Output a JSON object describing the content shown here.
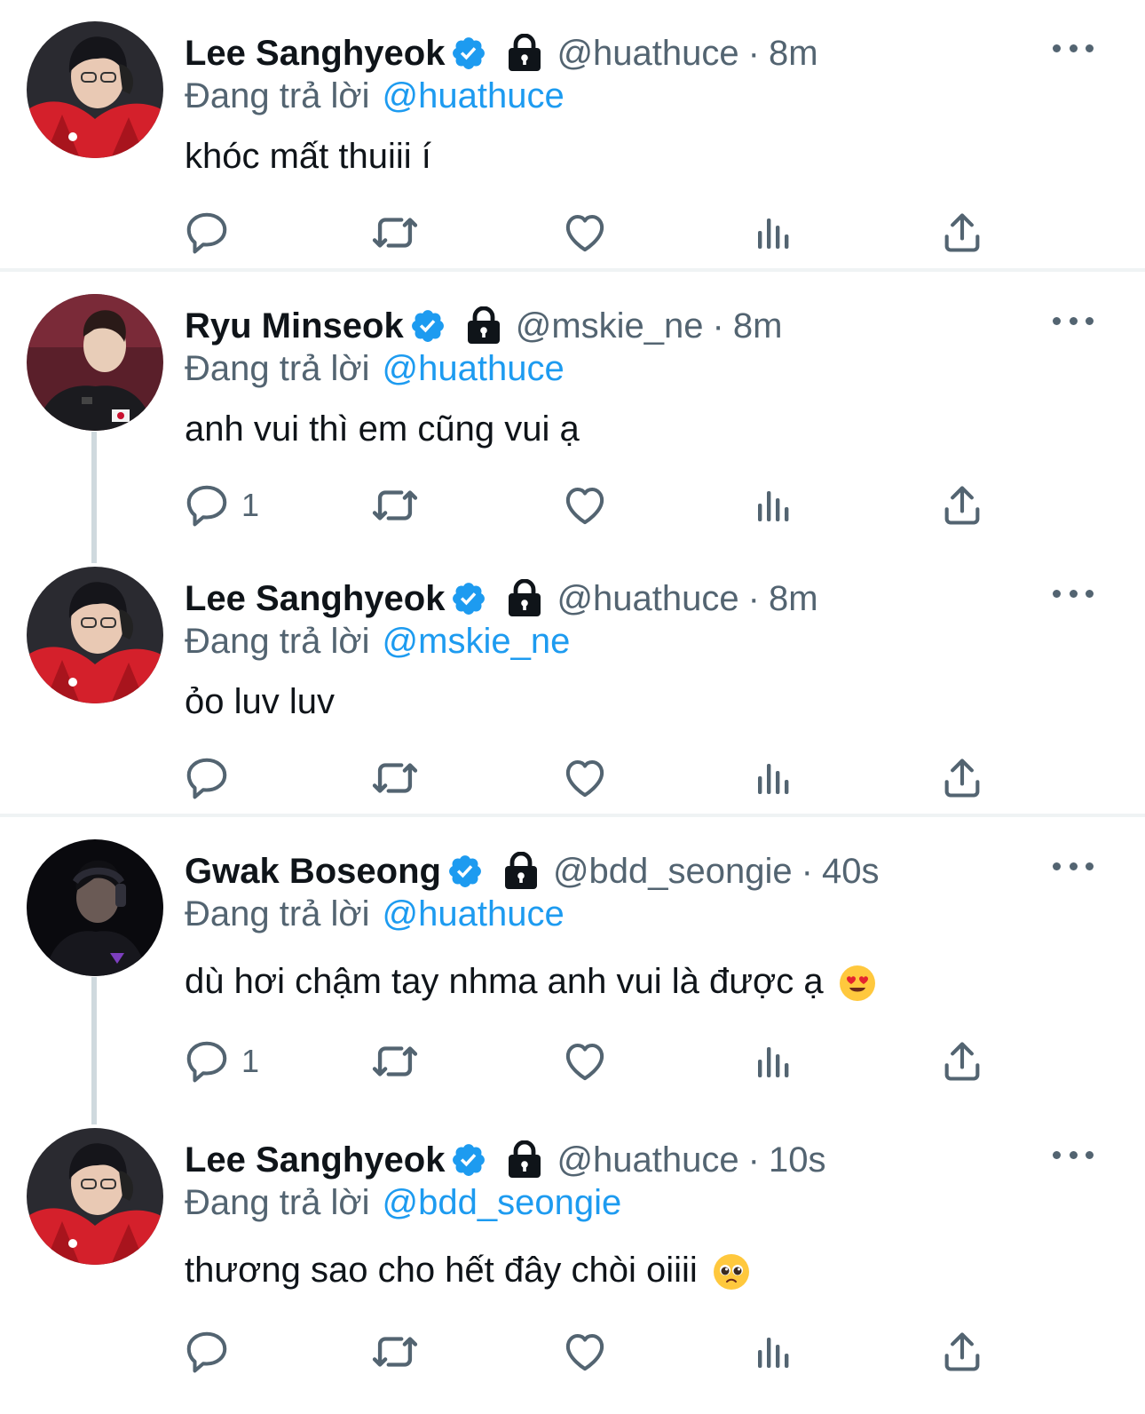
{
  "colors": {
    "accent": "#1d9bf0",
    "secondary_text": "#536471",
    "primary_text": "#0f1419",
    "verified": "#1d9bf0"
  },
  "tweets": [
    {
      "name": "Lee Sanghyeok",
      "handle": "@huathuce",
      "time": "8m",
      "reply_label": "Đang trả lời",
      "reply_to": "@huathuce",
      "text": "khóc mất thuiii í",
      "emoji": "",
      "reply_count": "",
      "avatar": "red-jacket-headset-avatar"
    },
    {
      "name": "Ryu Minseok",
      "handle": "@mskie_ne",
      "time": "8m",
      "reply_label": "Đang trả lời",
      "reply_to": "@huathuce",
      "text": "anh vui thì em cũng vui ạ",
      "emoji": "",
      "reply_count": "1",
      "avatar": "black-jersey-avatar"
    },
    {
      "name": "Lee Sanghyeok",
      "handle": "@huathuce",
      "time": "8m",
      "reply_label": "Đang trả lời",
      "reply_to": "@mskie_ne",
      "text": "ỏo luv luv",
      "emoji": "",
      "reply_count": "",
      "avatar": "red-jacket-headset-avatar"
    },
    {
      "name": "Gwak Boseong",
      "handle": "@bdd_seongie",
      "time": "40s",
      "reply_label": "Đang trả lời",
      "reply_to": "@huathuce",
      "text": "dù hơi chậm tay nhma anh vui là được ạ",
      "emoji": "heart-eyes",
      "reply_count": "1",
      "avatar": "dark-headset-avatar"
    },
    {
      "name": "Lee Sanghyeok",
      "handle": "@huathuce",
      "time": "10s",
      "reply_label": "Đang trả lời",
      "reply_to": "@bdd_seongie",
      "text": "thương sao cho hết đây chòi oiiii",
      "emoji": "pleading-face",
      "reply_count": "",
      "avatar": "red-jacket-headset-avatar"
    }
  ]
}
